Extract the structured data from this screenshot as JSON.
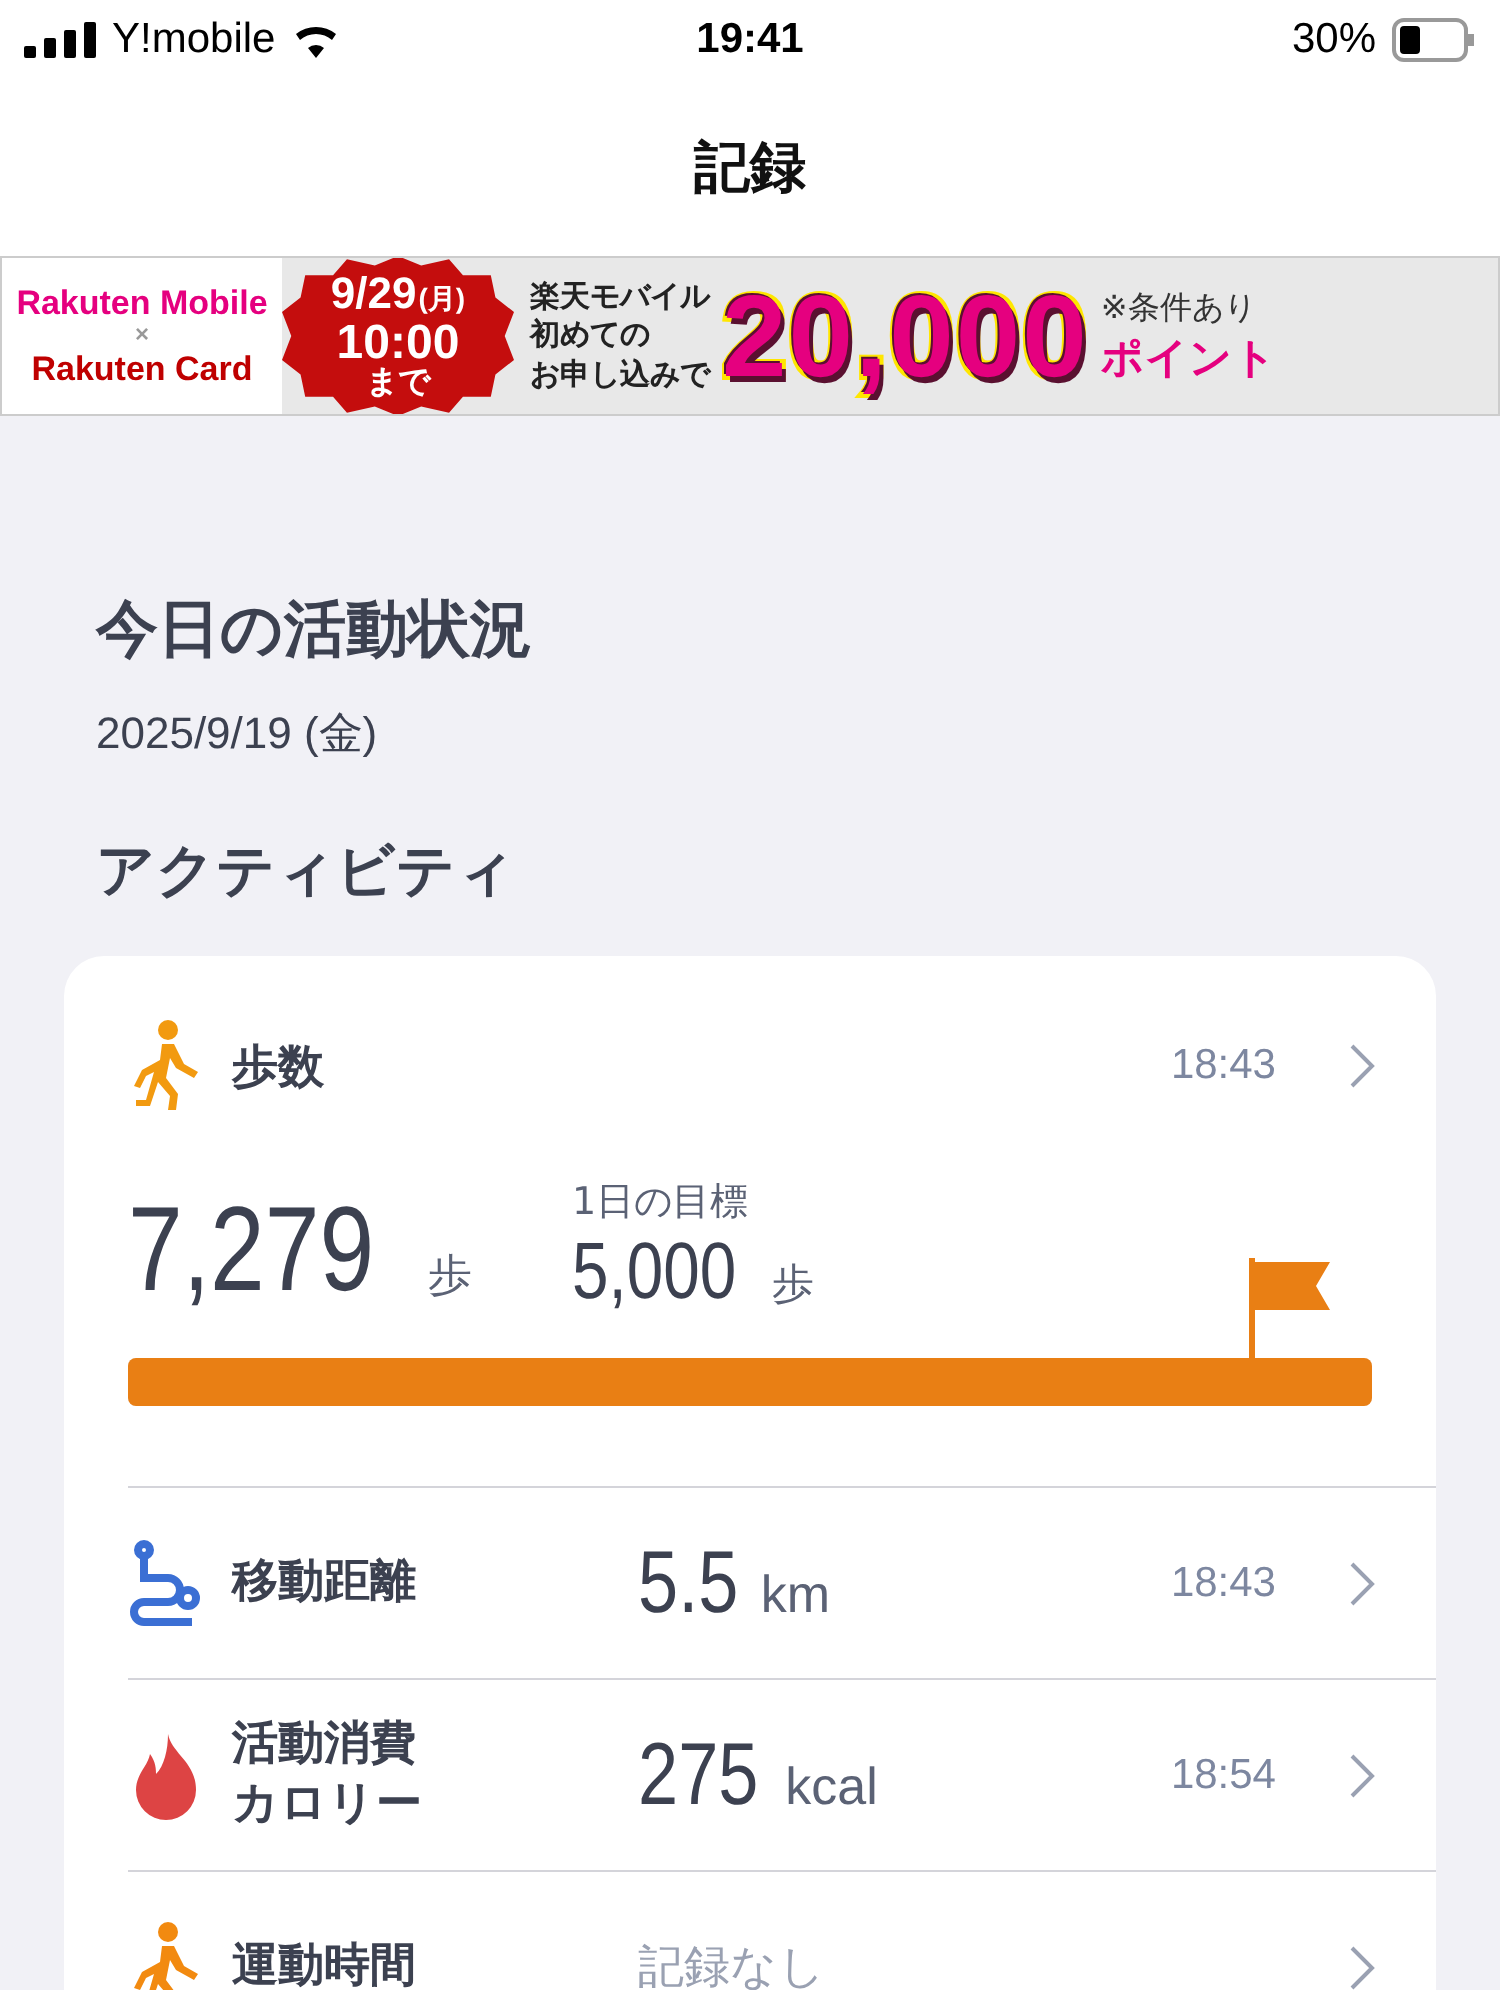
{
  "status_bar": {
    "carrier": "Y!mobile",
    "time": "19:41",
    "battery": "30%"
  },
  "nav": {
    "title": "記録"
  },
  "banner": {
    "brands": [
      "Rakuten Mobile",
      "×",
      "Rakuten Card"
    ],
    "deadline": [
      "9/29",
      "(月)",
      "10:00",
      "まで"
    ],
    "copy": [
      "楽天モバイル",
      "初めての",
      "お申し込みで"
    ],
    "amount": "20,000",
    "note": "※条件あり",
    "unit": "ポイント"
  },
  "heading": "今日の活動状況",
  "date": "2025/9/19 (金)",
  "section_title": "アクティビティ",
  "steps": {
    "kind": "steps",
    "label": "歩数",
    "time": "18:43",
    "value": "7,279",
    "unit": "歩",
    "goal_label": "1日の目標",
    "goal_value": "5,000",
    "goal_unit": "歩",
    "level": 1
  },
  "metrics": [
    {
      "kind": "distance",
      "label": "移動距離",
      "value": "5.5",
      "unit": "km",
      "time": "18:43"
    },
    {
      "kind": "calories",
      "label": "活動消費カロリー",
      "value": "275",
      "unit": "kcal",
      "time": "18:54"
    },
    {
      "kind": "exercise",
      "label": "運動時間",
      "placeholder": "記録なし"
    }
  ]
}
